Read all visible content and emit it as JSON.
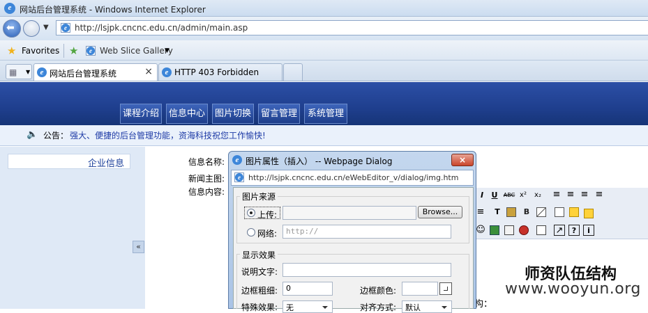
{
  "browser": {
    "window_title": "网站后台管理系统 - Windows Internet Explorer",
    "address": "http://lsjpk.cncnc.edu.cn/admin/main.asp",
    "favorites_label": "Favorites",
    "web_slice_label": "Web Slice Gallery",
    "tabs": [
      {
        "label": "网站后台管理系统",
        "active": true,
        "close": "×"
      },
      {
        "label": "HTTP 403 Forbidden",
        "active": false
      }
    ]
  },
  "site": {
    "menu": [
      "课程介绍",
      "信息中心",
      "图片切换",
      "留言管理",
      "系统管理"
    ],
    "notice_label": "公告：",
    "notice_text": "强大、便捷的后台管理功能，资海科技祝您工作愉快!",
    "sidebar_item": "企业信息",
    "collapse_label": "«",
    "form_labels": [
      "信息名称:",
      "新闻主图:",
      "信息内容:"
    ],
    "watermark_title": "师资队伍结构",
    "watermark_url": "www.wooyun.org",
    "content_fragment": "构："
  },
  "dialog": {
    "title": "图片属性（插入） -- Webpage Dialog",
    "close": "×",
    "address": "http://lsjpk.cncnc.edu.cn/eWebEditor_v/dialog/img.htm",
    "source_group": "图片来源",
    "upload_label": "上传:",
    "browse_button": "Browse...",
    "network_label": "网络:",
    "network_placeholder": "http://",
    "effect_group": "显示效果",
    "desc_label": "说明文字:",
    "border_width_label": "边框粗细:",
    "border_width_value": "0",
    "border_color_label": "边框颜色:",
    "special_label": "特殊效果:",
    "special_value": "无",
    "align_label": "对齐方式:",
    "align_value": "默认"
  },
  "editor_toolbar": {
    "row1": [
      "I",
      "U",
      "ABC",
      "x²",
      "x₂"
    ],
    "row3_help": "?",
    "row3_info": "i"
  },
  "colors": {
    "banner": "#1f3f8e",
    "sidebar": "#dfe9f6",
    "notice_text": "#1d3aa6"
  }
}
